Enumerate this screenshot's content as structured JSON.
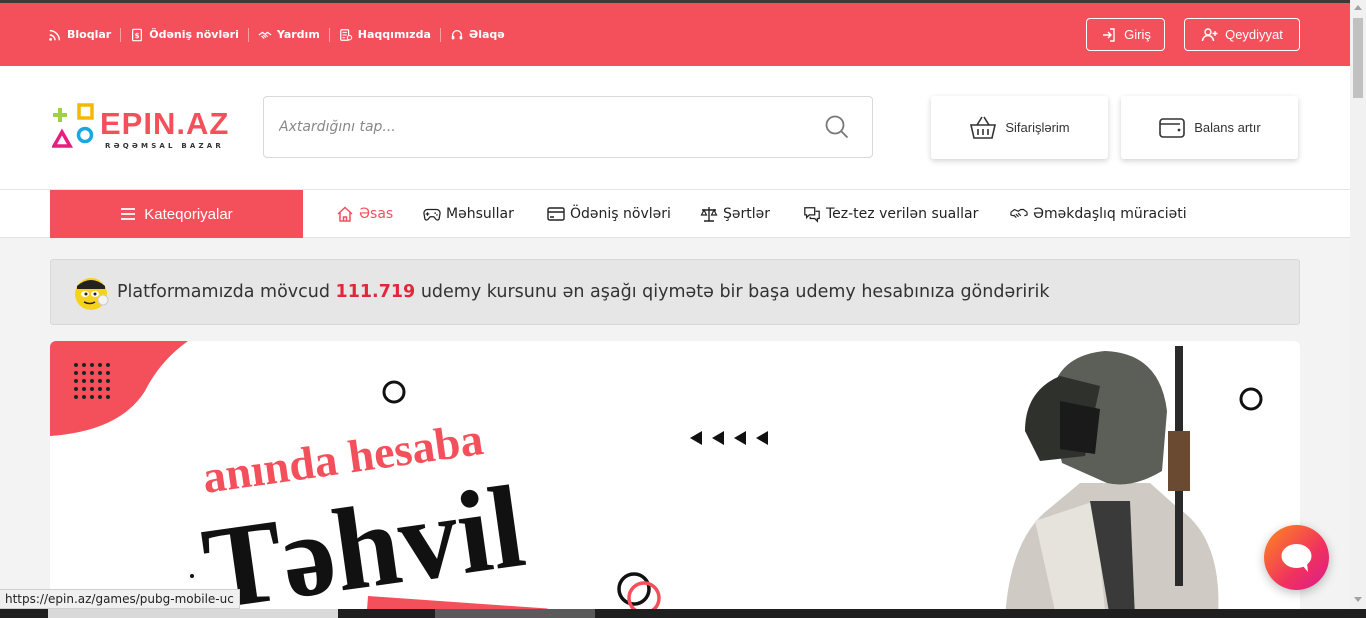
{
  "topbar": {
    "links": [
      {
        "label": "Bloqlar",
        "icon": "rss-icon"
      },
      {
        "label": "Ödəniş növləri",
        "icon": "receipt-icon"
      },
      {
        "label": "Yardım",
        "icon": "handshake-icon"
      },
      {
        "label": "Haqqımızda",
        "icon": "document-icon"
      },
      {
        "label": "Əlaqə",
        "icon": "headset-icon"
      }
    ],
    "login_label": "Giriş",
    "register_label": "Qeydiyyat"
  },
  "header": {
    "logo_text": "EPIN.AZ",
    "logo_sub": "RƏQƏMSAL BAZAR",
    "search_placeholder": "Axtardığını tap...",
    "orders_label": "Sifarişlərim",
    "balance_label": "Balans artır"
  },
  "nav": {
    "categories_label": "Kateqoriyalar",
    "items": [
      {
        "label": "Əsas",
        "icon": "home-icon",
        "active": true
      },
      {
        "label": "Məhsullar",
        "icon": "gamepad-icon"
      },
      {
        "label": "Ödəniş növləri",
        "icon": "card-icon"
      },
      {
        "label": "Şərtlər",
        "icon": "scales-icon"
      },
      {
        "label": "Tez-tez verilən suallar",
        "icon": "chat-question-icon"
      },
      {
        "label": "Əməkdaşlıq müraciəti",
        "icon": "partnership-icon"
      }
    ]
  },
  "notice": {
    "prefix": "Platformamızda mövcud",
    "number": "111.719",
    "suffix": "udemy kursunu ən aşağı qiymətə bir başa udemy hesabınıza göndəririk"
  },
  "banner": {
    "line1": "anında hesaba",
    "line2": "Təhvil"
  },
  "statusbar": {
    "url": "https://epin.az/games/pubg-mobile-uc"
  },
  "colors": {
    "brand": "#f4505b",
    "highlight": "#e0283a"
  }
}
